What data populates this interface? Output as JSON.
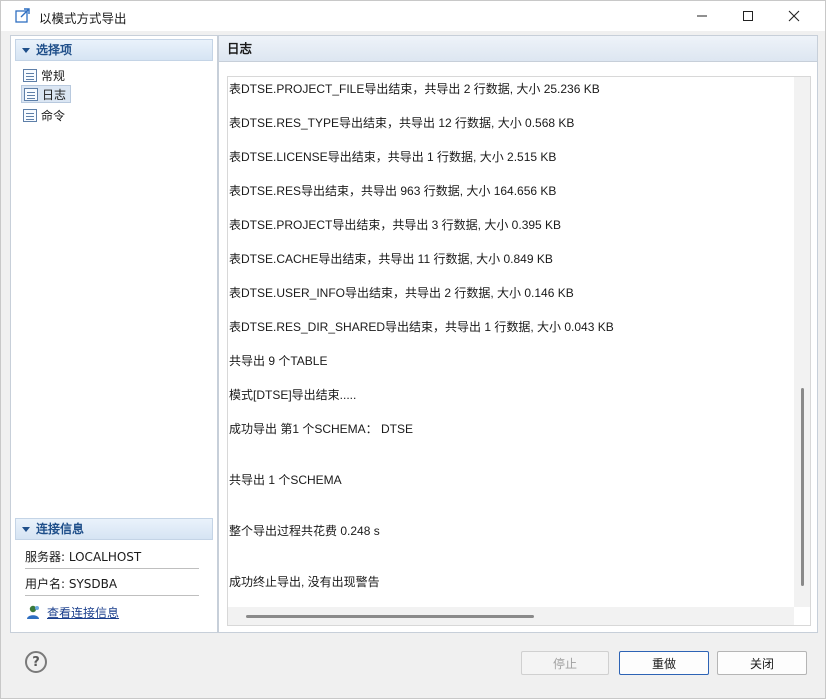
{
  "window": {
    "title": "以模式方式导出"
  },
  "left": {
    "options_header": "选择项",
    "nav": [
      {
        "label": "常规"
      },
      {
        "label": "日志"
      },
      {
        "label": "命令"
      }
    ],
    "selected_nav": "日志",
    "connection_header": "连接信息",
    "server": "服务器: LOCALHOST",
    "user": "用户名: SYSDBA",
    "view_conn_link": "查看连接信息"
  },
  "log": {
    "header": "日志",
    "lines": [
      "表DTSE.PROJECT_FILE导出结束，共导出 2 行数据, 大小 25.236 KB",
      "表DTSE.RES_TYPE导出结束，共导出 12 行数据, 大小 0.568 KB",
      "表DTSE.LICENSE导出结束，共导出 1 行数据, 大小 2.515 KB",
      "表DTSE.RES导出结束，共导出 963 行数据, 大小 164.656 KB",
      "表DTSE.PROJECT导出结束，共导出 3 行数据, 大小 0.395 KB",
      "表DTSE.CACHE导出结束，共导出 11 行数据, 大小 0.849 KB",
      "表DTSE.USER_INFO导出结束，共导出 2 行数据, 大小 0.146 KB",
      "表DTSE.RES_DIR_SHARED导出结束，共导出 1 行数据, 大小 0.043 KB",
      "共导出 9 个TABLE",
      "模式[DTSE]导出结束.....",
      "成功导出 第1 个SCHEMA： DTSE",
      "共导出 1 个SCHEMA",
      "整个导出过程共花费    0.248 s",
      "成功终止导出, 没有出现警告"
    ]
  },
  "buttons": {
    "stop": "停止",
    "redo": "重做",
    "close": "关闭",
    "help": "?"
  },
  "colors": {
    "accent": "#2d63b5",
    "section_header_text": "#1f4f8a"
  }
}
